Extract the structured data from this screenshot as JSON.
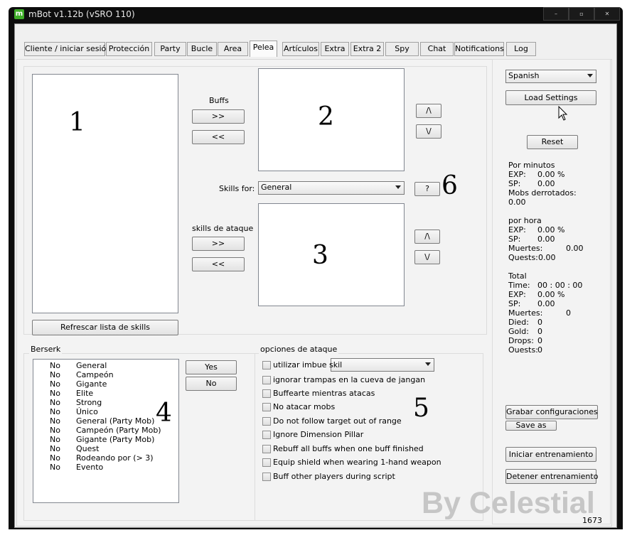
{
  "window": {
    "title": "mBot v1.12b (vSRO 110)",
    "logo": "m",
    "buttons": [
      "–",
      "▫",
      "✕"
    ]
  },
  "tabs": [
    "Cliente / iniciar sesión",
    "Protección",
    "Party",
    "Bucle",
    "Area",
    "Pelea",
    "Artículos",
    "Extra",
    "Extra 2",
    "Spy",
    "Chat",
    "Notifications",
    "Log"
  ],
  "active_tab": "Pelea",
  "markers": [
    "1",
    "2",
    "3",
    "4",
    "5",
    "6"
  ],
  "skills": {
    "refresh_button": "Refrescar lista de skills",
    "buffs_label": "Buffs",
    "attack_label": "skills de ataque",
    "add_button": ">>",
    "remove_button": "<<",
    "up_button": "/\\",
    "down_button": "\\/",
    "skills_for_label": "Skills for:",
    "skills_for_value": "General",
    "help_button": "?"
  },
  "berserk": {
    "title": "Berserk",
    "yes_button": "Yes",
    "no_button": "No",
    "rows": [
      {
        "state": "No",
        "name": "General"
      },
      {
        "state": "No",
        "name": "Campeón"
      },
      {
        "state": "No",
        "name": "Gigante"
      },
      {
        "state": "No",
        "name": "Elite"
      },
      {
        "state": "No",
        "name": "Strong"
      },
      {
        "state": "No",
        "name": "Único"
      },
      {
        "state": "No",
        "name": "General (Party Mob)"
      },
      {
        "state": "No",
        "name": "Campeón (Party Mob)"
      },
      {
        "state": "No",
        "name": "Gigante (Party Mob)"
      },
      {
        "state": "No",
        "name": "Quest"
      },
      {
        "state": "No",
        "name": "Rodeando por (> 3)"
      },
      {
        "state": "No",
        "name": "Evento"
      }
    ]
  },
  "attack_options": {
    "title": "opciones de ataque",
    "options": [
      "utilizar imbue skil",
      "ignorar trampas en la cueva de jangan",
      "Buffearte mientras atacas",
      "No atacar mobs",
      "Do not follow target out of range",
      "Ignore Dimension Pillar",
      "Rebuff all buffs when one buff finished",
      "Equip shield when wearing 1-hand weapon",
      "Buff other players during script"
    ],
    "imbue_value": ""
  },
  "side": {
    "language": "Spanish",
    "load_settings": "Load Settings",
    "reset": "Reset",
    "save_config": "Grabar configuraciones",
    "save_as": "Save as",
    "start": "Iniciar entrenamiento",
    "stop": "Detener entrenamiento"
  },
  "stats": {
    "per_minute": {
      "title": "Por minutos",
      "exp_label": "EXP:",
      "exp": "0.00 %",
      "sp_label": "SP:",
      "sp": "0.00",
      "mobs_label": "Mobs derrotados:",
      "mobs": "0.00"
    },
    "per_hour": {
      "title": "por hora",
      "exp_label": "EXP:",
      "exp": "0.00 %",
      "sp_label": "SP:",
      "sp": "0.00",
      "deaths_label": "Muertes:",
      "deaths": "0.00",
      "quests_label": "Quests:",
      "quests": "0.00"
    },
    "total": {
      "title": "Total",
      "time_label": "Time:",
      "time": "00 : 00 : 00",
      "exp_label": "EXP:",
      "exp": "0.00 %",
      "sp_label": "SP:",
      "sp": "0.00",
      "deaths_label": "Muertes:",
      "deaths": "0",
      "died_label": "Died:",
      "died": "0",
      "gold_label": "Gold:",
      "gold": "0",
      "drops_label": "Drops:",
      "drops": "0",
      "quests_label": "Ouests:",
      "quests": "0"
    }
  },
  "status_number": "1673",
  "watermark": "By Celestial"
}
